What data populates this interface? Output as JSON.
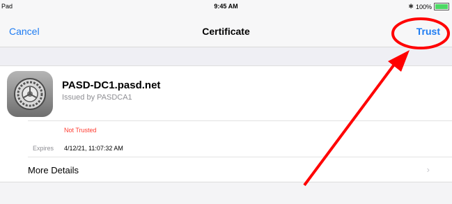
{
  "status": {
    "carrier": "Pad",
    "time": "9:45 AM",
    "battery": "100%"
  },
  "nav": {
    "cancel": "Cancel",
    "title": "Certificate",
    "trust": "Trust"
  },
  "certificate": {
    "name": "PASD-DC1.pasd.net",
    "issuer": "Issued by PASDCA1",
    "trust_status": "Not Trusted",
    "expires_label": "Expires",
    "expires_value": "4/12/21, 11:07:32 AM"
  },
  "more_details": {
    "label": "More Details",
    "chevron": "›"
  },
  "annotation": {
    "color": "#ff0000"
  }
}
